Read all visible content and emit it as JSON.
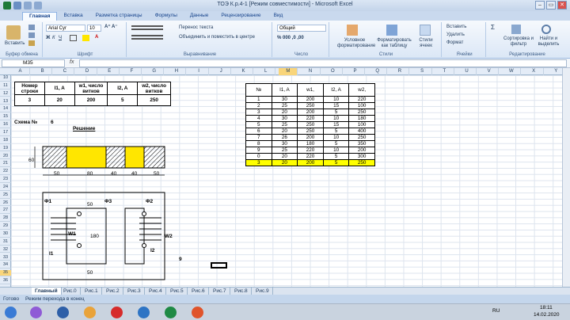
{
  "window": {
    "title": "ТОЭ К.р.4-1  [Режим совместимости] - Microsoft Excel"
  },
  "ribbon": {
    "tabs": [
      "Главная",
      "Вставка",
      "Разметка страницы",
      "Формулы",
      "Данные",
      "Рецензирование",
      "Вид"
    ],
    "groups": {
      "clipboard": "Буфер обмена",
      "font": "Шрифт",
      "alignment": "Выравнивание",
      "number": "Число",
      "styles": "Стили",
      "cells": "Ячейки",
      "editing": "Редактирование"
    },
    "paste_label": "Вставить",
    "font_name": "Arial Cyr",
    "font_size": "10",
    "wrap_text": "Перенос текста",
    "merge_center": "Объединить и поместить в центре",
    "number_format": "Общий",
    "cond_format": "Условное форматирование",
    "format_table": "Форматировать как таблицу",
    "cell_styles": "Стили ячеек",
    "insert": "Вставить",
    "delete": "Удалить",
    "format": "Формат",
    "sort_filter": "Сортировка и фильтр",
    "find_select": "Найти и выделить"
  },
  "formula_bar": {
    "name_box": "M35",
    "fx": "fx",
    "content": ""
  },
  "columns": [
    "A",
    "B",
    "C",
    "D",
    "E",
    "F",
    "G",
    "H",
    "I",
    "J",
    "K",
    "L",
    "M",
    "N",
    "O",
    "P",
    "Q",
    "R",
    "S",
    "T",
    "U",
    "V",
    "W",
    "X",
    "Y"
  ],
  "selected_column": "M",
  "rows": [
    "10",
    "11",
    "12",
    "13",
    "14",
    "15",
    "16",
    "17",
    "18",
    "19",
    "20",
    "21",
    "22",
    "23",
    "24",
    "25",
    "26",
    "27",
    "28",
    "29",
    "30",
    "31",
    "32",
    "33",
    "34",
    "35",
    "36"
  ],
  "selected_row": "35",
  "left_table": {
    "headers": [
      "Номер строки",
      "I1, A",
      "w1, число витков",
      "I2, A",
      "w2, число витков"
    ],
    "values": [
      "3",
      "20",
      "200",
      "5",
      "250"
    ]
  },
  "scheme_label": "Схема №",
  "scheme_number": "6",
  "solution_label": "Решение",
  "drawing": {
    "dimensions": [
      "60",
      "50",
      "80",
      "40",
      "40",
      "50"
    ],
    "labels": [
      "Ф1",
      "Ф3",
      "Ф2",
      "W1",
      "W2",
      "I1",
      "I2",
      "50",
      "180",
      "50",
      "9"
    ]
  },
  "right_table": {
    "headers": [
      "№",
      "I1, A",
      "w1,",
      "I2, A",
      "w2,"
    ],
    "rows": [
      [
        "1",
        "30",
        "200",
        "10",
        "220"
      ],
      [
        "2",
        "25",
        "250",
        "15",
        "100"
      ],
      [
        "3",
        "20",
        "200",
        "5",
        "250"
      ],
      [
        "4",
        "30",
        "220",
        "10",
        "180"
      ],
      [
        "5",
        "25",
        "250",
        "15",
        "100"
      ],
      [
        "6",
        "20",
        "250",
        "5",
        "400"
      ],
      [
        "7",
        "26",
        "200",
        "10",
        "250"
      ],
      [
        "8",
        "30",
        "180",
        "5",
        "350"
      ],
      [
        "9",
        "25",
        "220",
        "10",
        "200"
      ],
      [
        "0",
        "20",
        "220",
        "5",
        "300"
      ],
      [
        "3",
        "20",
        "200",
        "5",
        "250"
      ]
    ],
    "highlight_color": "#ffff00"
  },
  "sheet_tabs": [
    "Главный",
    "Рис.0",
    "Рис.1",
    "Рис.2",
    "Рис.3",
    "Рис.4",
    "Рис.5",
    "Рис.6",
    "Рис.7",
    "Рис.8",
    "Рис.9"
  ],
  "status": {
    "ready": "Готово",
    "mode": "Режим перехода в конец"
  },
  "taskbar": {
    "lang": "RU",
    "time": "18:11",
    "date": "14.02.2020"
  }
}
